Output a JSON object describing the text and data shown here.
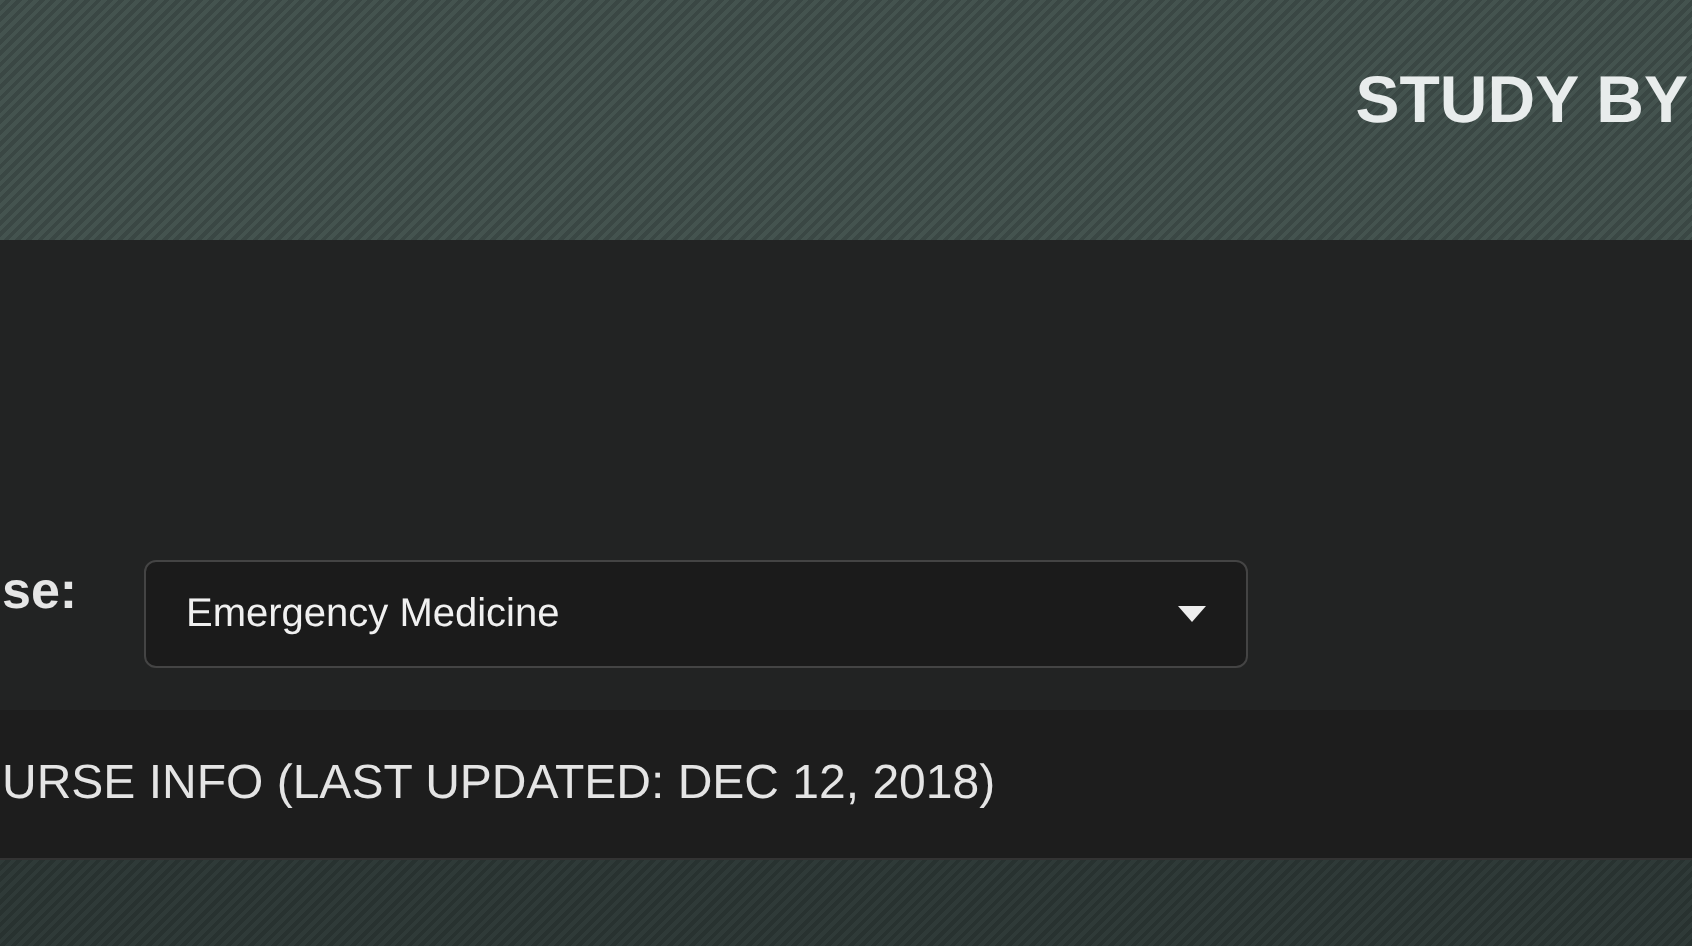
{
  "header": {
    "title": "STUDY BY"
  },
  "course_select": {
    "label": "se:",
    "value": "Emergency Medicine"
  },
  "course_info": {
    "title": "URSE INFO (LAST UPDATED: DEC 12, 2018)"
  }
}
